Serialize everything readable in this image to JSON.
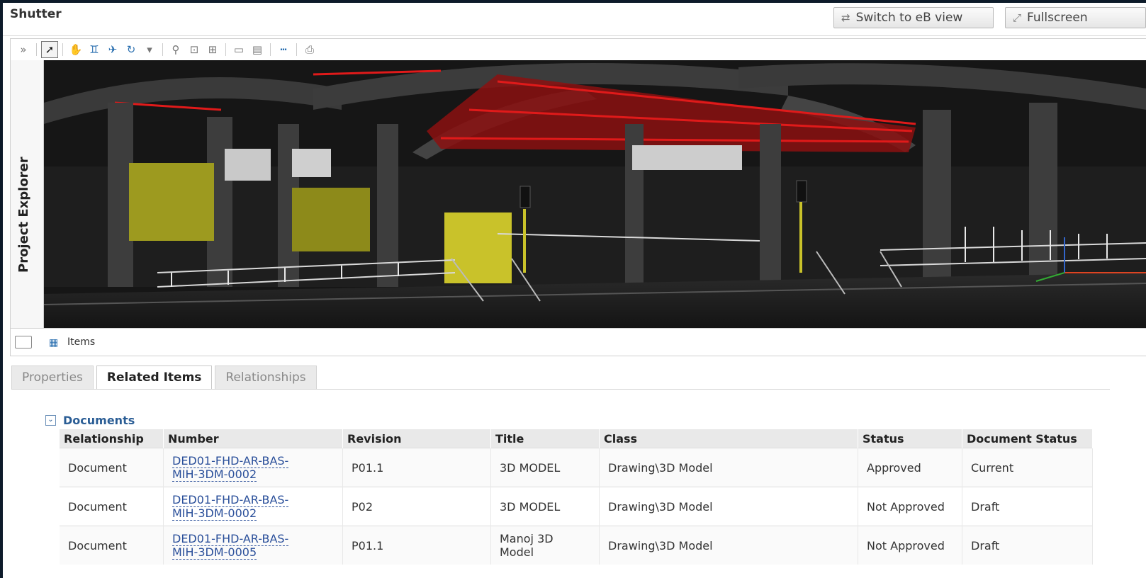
{
  "title": "Shutter",
  "buttons": {
    "switch_view": "Switch to eB view",
    "fullscreen": "Fullscreen"
  },
  "sidepanel": {
    "label": "Project Explorer"
  },
  "viewer_footer": {
    "items_label": "Items"
  },
  "tabs": [
    "Properties",
    "Related Items",
    "Relationships"
  ],
  "active_tab": "Related Items",
  "section": {
    "name": "Documents"
  },
  "table": {
    "headers": [
      "Relationship",
      "Number",
      "Revision",
      "Title",
      "Class",
      "Status",
      "Document Status"
    ],
    "rows": [
      {
        "relationship": "Document",
        "number_line1": "DED01-FHD-AR-BAS-",
        "number_line2": "MIH-3DM-0002",
        "revision": "P01.1",
        "title": "3D MODEL",
        "class": "Drawing\\3D Model",
        "status": "Approved",
        "doc_status": "Current"
      },
      {
        "relationship": "Document",
        "number_line1": "DED01-FHD-AR-BAS-",
        "number_line2": "MIH-3DM-0002",
        "revision": "P02",
        "title": "3D MODEL",
        "class": "Drawing\\3D Model",
        "status": "Not Approved",
        "doc_status": "Draft"
      },
      {
        "relationship": "Document",
        "number_line1": "DED01-FHD-AR-BAS-",
        "number_line2": "MIH-3DM-0005",
        "revision": "P01.1",
        "title": "Manoj 3D Model",
        "class": "Drawing\\3D Model",
        "status": "Not Approved",
        "doc_status": "Draft"
      }
    ]
  },
  "colors": {
    "link": "#2a4f9a",
    "section": "#2a5d95",
    "scene_bg": "#111111",
    "steel_highlight": "#d81818",
    "wall_yellow": "#c9c22a"
  }
}
